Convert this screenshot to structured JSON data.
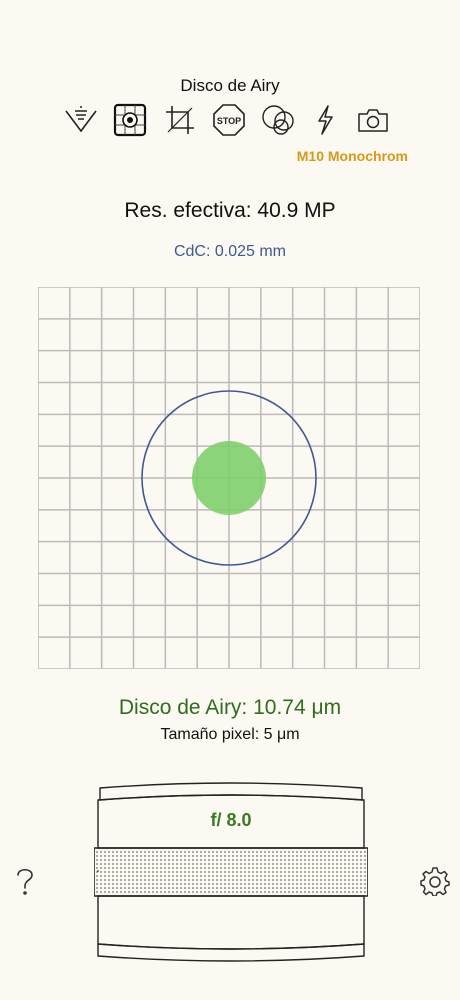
{
  "header": {
    "title": "Disco de Airy"
  },
  "toolbar": {
    "tools": [
      {
        "name": "depth-of-field-icon"
      },
      {
        "name": "airy-disc-icon",
        "selected": true
      },
      {
        "name": "crop-icon"
      },
      {
        "name": "stop-icon",
        "text": "STOP"
      },
      {
        "name": "circles-icon"
      },
      {
        "name": "flash-icon"
      },
      {
        "name": "camera-icon"
      }
    ]
  },
  "camera": {
    "model": "M10 Monochrom",
    "color": "#d79a16"
  },
  "results": {
    "effective_resolution": "Res. efectiva: 40.9 MP",
    "coc": "CdC: 0.025 mm",
    "airy_disc": "Disco de Airy: 10.74 μm",
    "pixel_size": "Tamaño pixel: 5 μm"
  },
  "lens": {
    "aperture": "f/ 8.0"
  },
  "colors": {
    "airy_text": "#2e6e1e",
    "coc_text": "#3d5a94",
    "airy_fill": "#7fcf6c",
    "coc_circle": "#3d5a94",
    "grid_line": "#bbbbbb",
    "background": "#fcf8f2"
  },
  "footer": {
    "help_icon": "question-icon",
    "settings_icon": "gear-icon"
  }
}
